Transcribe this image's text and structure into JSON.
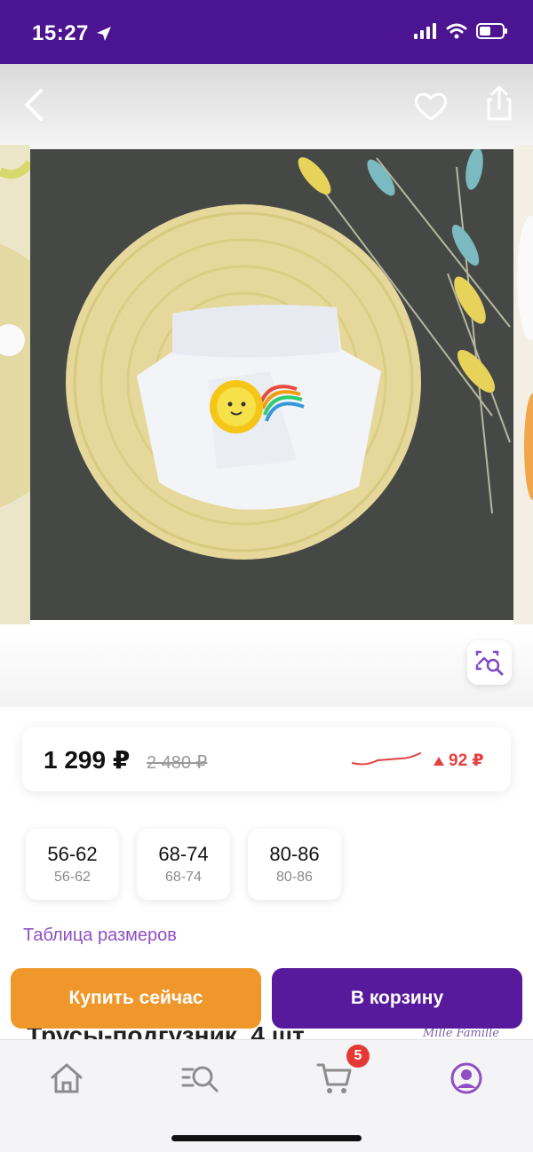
{
  "status_bar": {
    "time": "15:27",
    "icons": [
      "location-arrow-icon",
      "signal-icon",
      "wifi-icon",
      "battery-icon"
    ]
  },
  "header": {
    "icons": [
      "back-icon",
      "heart-icon",
      "share-icon"
    ]
  },
  "gallery": {
    "search_by_image_icon": "image-search-icon"
  },
  "price": {
    "current": "1 299 ₽",
    "old": "2 480 ₽",
    "change": "92 ₽",
    "change_direction": "up",
    "change_color": "#e54040"
  },
  "sizes": [
    {
      "label": "56-62",
      "sub": "56-62"
    },
    {
      "label": "68-74",
      "sub": "68-74"
    },
    {
      "label": "80-86",
      "sub": "80-86"
    }
  ],
  "size_table_link": "Таблица размеров",
  "product_title_peek": "Трусы-подгузник, 4 шт",
  "brand_peek": "Mille Famille",
  "actions": {
    "buy_now": "Купить сейчас",
    "add_to_cart": "В корзину",
    "buy_color": "#f0972b",
    "cart_color": "#581a9c"
  },
  "tab_bar": {
    "cart_badge": "5",
    "icons": [
      "home-icon",
      "catalog-search-icon",
      "cart-icon",
      "profile-icon"
    ],
    "active_color": "#8f4ec4"
  },
  "colors": {
    "brand": "#4b1491"
  }
}
